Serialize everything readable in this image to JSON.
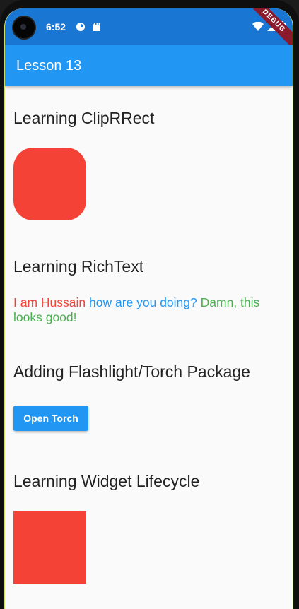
{
  "status_bar": {
    "time": "6:52",
    "icons": [
      "sync-icon",
      "sd-card-icon",
      "wifi-icon",
      "signal-icon",
      "battery-icon"
    ],
    "debug_label": "DEBUG"
  },
  "app_bar": {
    "title": "Lesson 13"
  },
  "sections": {
    "cliprrect_title": "Learning ClipRRect",
    "richtext_title": "Learning RichText",
    "torch_title": "Adding Flashlight/Torch Package",
    "lifecycle_title": "Learning Widget Lifecycle"
  },
  "rich_text": {
    "part1": "I am Hussain",
    "part2": "how are you doing?",
    "part3": "Damn, this looks good!"
  },
  "torch_button": {
    "label": "Open Torch"
  },
  "colors": {
    "primary": "#2196f3",
    "status_bar": "#1976d2",
    "red_box": "#f44336",
    "rich_red": "#f44336",
    "rich_blue": "#2196f3",
    "rich_green": "#4caf50"
  }
}
